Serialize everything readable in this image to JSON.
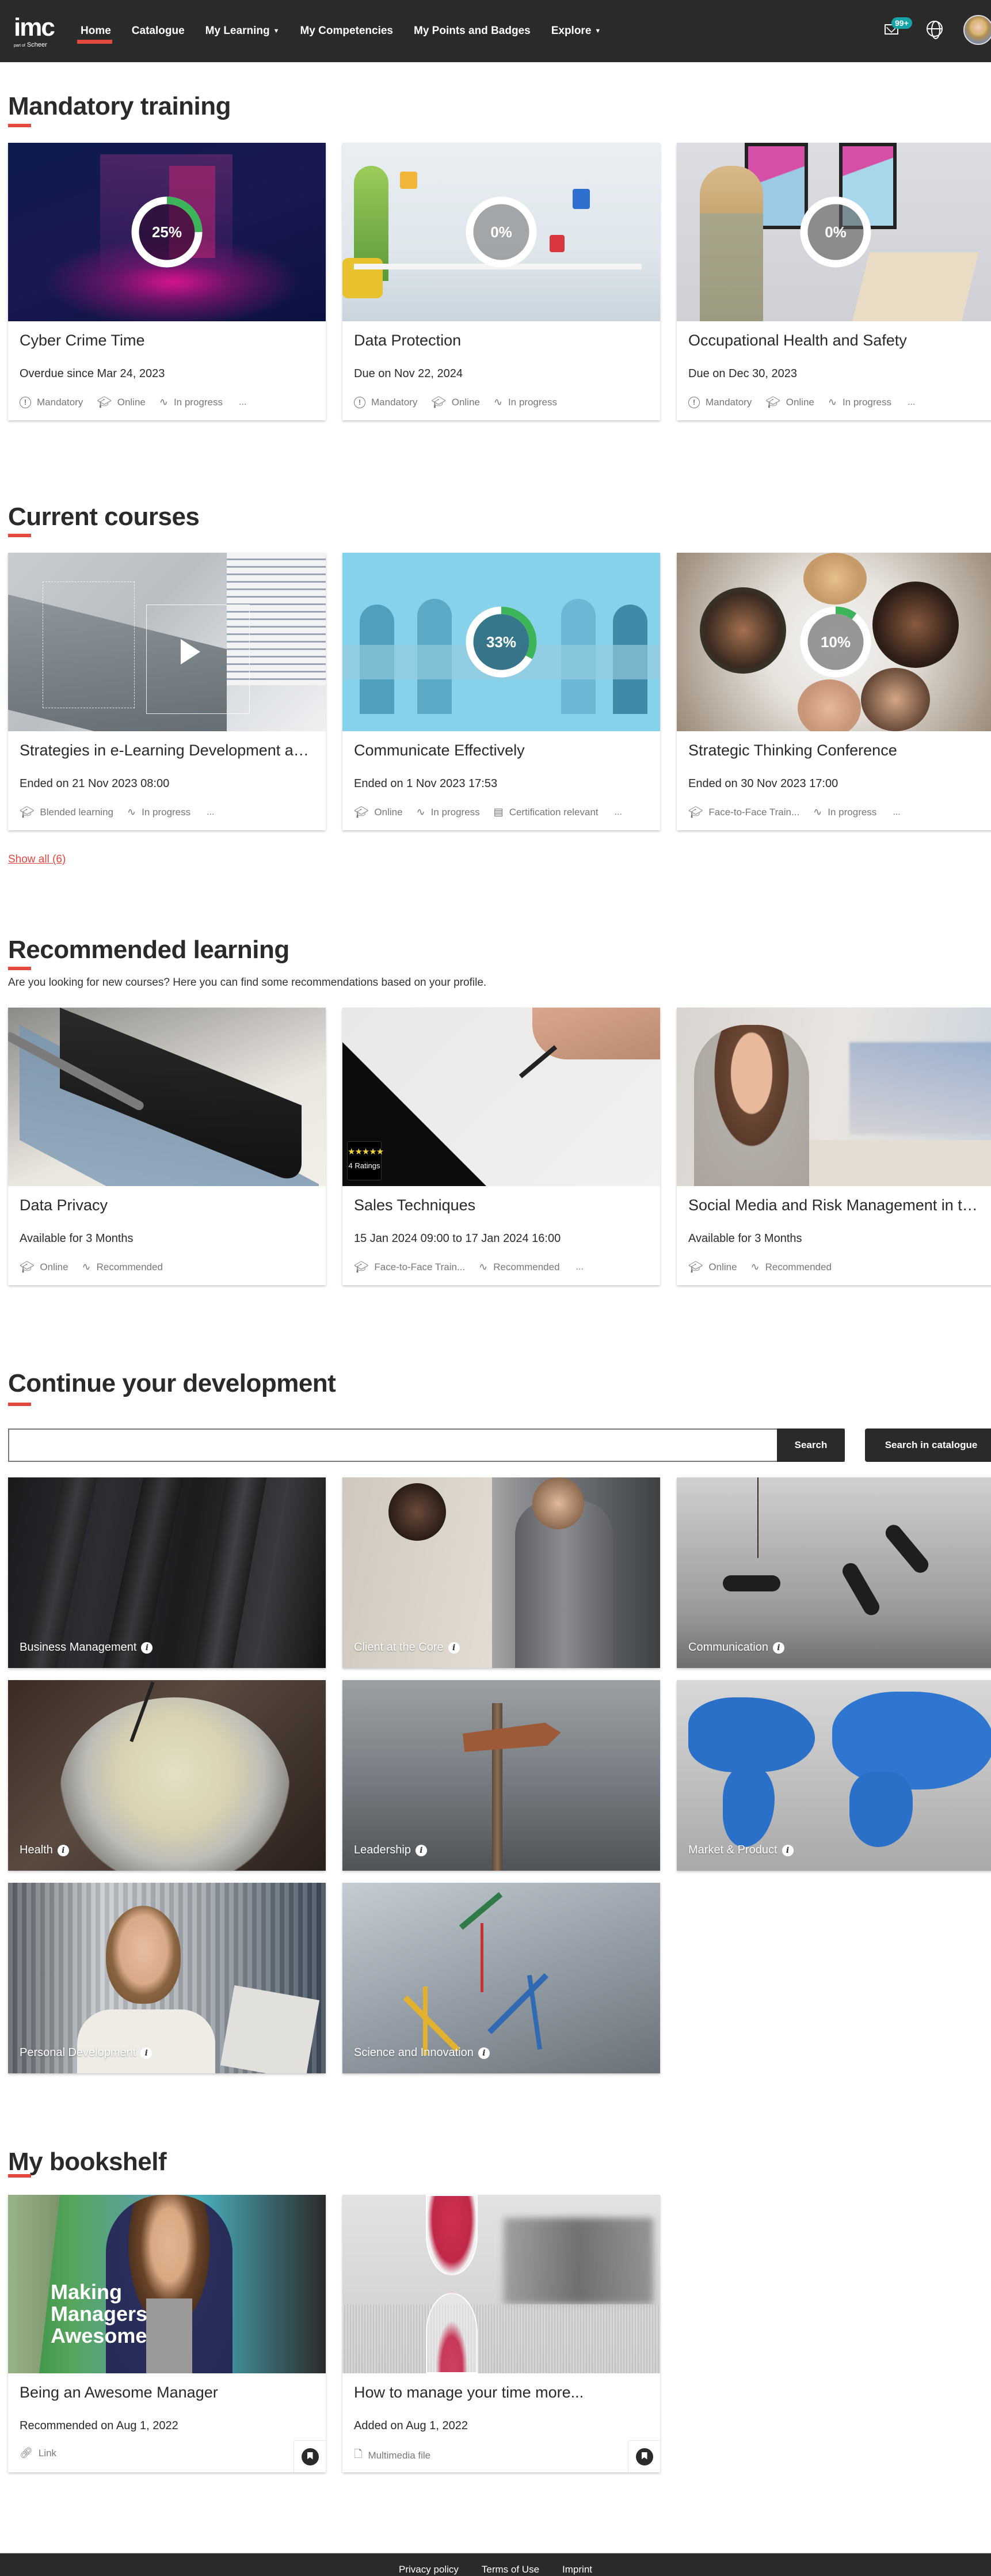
{
  "nav": {
    "logo_main": "imc",
    "logo_sub_prefix": "part of",
    "logo_sub": "Scheer",
    "items": [
      {
        "label": "Home",
        "active": true,
        "dropdown": false
      },
      {
        "label": "Catalogue",
        "active": false,
        "dropdown": false
      },
      {
        "label": "My Learning",
        "active": false,
        "dropdown": true
      },
      {
        "label": "My Competencies",
        "active": false,
        "dropdown": false
      },
      {
        "label": "My Points and Badges",
        "active": false,
        "dropdown": false
      },
      {
        "label": "Explore",
        "active": false,
        "dropdown": true
      }
    ],
    "caret": "▼",
    "mail_badge": "99+",
    "icons": {
      "mail": "mail-icon",
      "language": "globe-icon",
      "user": "avatar"
    }
  },
  "mandatory": {
    "title": "Mandatory training",
    "cards": [
      {
        "title": "Cyber Crime Time",
        "date": "Overdue since Mar 24, 2023",
        "progress": "25%",
        "progress_value": 25,
        "meta": [
          {
            "icon": "exclamation-circle-icon",
            "label": "Mandatory"
          },
          {
            "icon": "graduation-cap-icon",
            "label": "Online"
          },
          {
            "icon": "pulse-icon",
            "label": "In progress"
          }
        ],
        "more": "..."
      },
      {
        "title": "Data Protection",
        "date": "Due on Nov 22, 2024",
        "progress": "0%",
        "progress_value": 0,
        "meta": [
          {
            "icon": "exclamation-circle-icon",
            "label": "Mandatory"
          },
          {
            "icon": "graduation-cap-icon",
            "label": "Online"
          },
          {
            "icon": "pulse-icon",
            "label": "In progress"
          }
        ],
        "more": ""
      },
      {
        "title": "Occupational Health and Safety",
        "date": "Due on Dec 30, 2023",
        "progress": "0%",
        "progress_value": 0,
        "meta": [
          {
            "icon": "exclamation-circle-icon",
            "label": "Mandatory"
          },
          {
            "icon": "graduation-cap-icon",
            "label": "Online"
          },
          {
            "icon": "pulse-icon",
            "label": "In progress"
          }
        ],
        "more": "..."
      }
    ]
  },
  "current": {
    "title": "Current courses",
    "cards": [
      {
        "title": "Strategies in e-Learning Development and...",
        "date": "Ended on 21 Nov 2023 08:00",
        "meta": [
          {
            "icon": "graduation-cap-icon",
            "label": "Blended learning"
          },
          {
            "icon": "pulse-icon",
            "label": "In progress"
          }
        ],
        "more": "..."
      },
      {
        "title": "Communicate Effectively",
        "date": "Ended on 1 Nov 2023 17:53",
        "progress": "33%",
        "progress_value": 33,
        "meta": [
          {
            "icon": "graduation-cap-icon",
            "label": "Online"
          },
          {
            "icon": "pulse-icon",
            "label": "In progress"
          },
          {
            "icon": "certificate-icon",
            "label": "Certification relevant"
          }
        ],
        "more": "..."
      },
      {
        "title": "Strategic Thinking Conference",
        "date": "Ended on 30 Nov 2023 17:00",
        "progress": "10%",
        "progress_value": 10,
        "meta": [
          {
            "icon": "graduation-cap-icon",
            "label": "Face-to-Face Train..."
          },
          {
            "icon": "pulse-icon",
            "label": "In progress"
          }
        ],
        "more": "..."
      }
    ],
    "show_all": "Show all (6)"
  },
  "recommended": {
    "title": "Recommended learning",
    "description": "Are you looking for new courses? Here you can find some recommendations based on your profile.",
    "cards": [
      {
        "title": "Data Privacy",
        "date": "Available for 3 Months",
        "meta": [
          {
            "icon": "graduation-cap-icon",
            "label": "Online"
          },
          {
            "icon": "pulse-icon",
            "label": "Recommended"
          }
        ],
        "more": ""
      },
      {
        "title": "Sales Techniques",
        "date": "15 Jan 2024 09:00 to 17 Jan 2024 16:00",
        "rating": {
          "stars": "★★★★★",
          "value": 5,
          "count_label": "4 Ratings"
        },
        "meta": [
          {
            "icon": "graduation-cap-icon",
            "label": "Face-to-Face Train..."
          },
          {
            "icon": "pulse-icon",
            "label": "Recommended"
          }
        ],
        "more": "..."
      },
      {
        "title": "Social Media and Risk Management in the...",
        "date": "Available for 3 Months",
        "meta": [
          {
            "icon": "graduation-cap-icon",
            "label": "Online"
          },
          {
            "icon": "pulse-icon",
            "label": "Recommended"
          }
        ],
        "more": ""
      }
    ]
  },
  "development": {
    "title": "Continue your development",
    "search_value": "",
    "search_placeholder": "",
    "search_button": "Search",
    "catalogue_button": "Search in catalogue",
    "tiles": [
      {
        "label": "Business Management"
      },
      {
        "label": "Client at the Core"
      },
      {
        "label": "Communication"
      },
      {
        "label": "Health"
      },
      {
        "label": "Leadership"
      },
      {
        "label": "Market & Product"
      },
      {
        "label": "Personal Development"
      },
      {
        "label": "Science and Innovation"
      }
    ],
    "info_glyph": "i"
  },
  "bookshelf": {
    "title": "My bookshelf",
    "cards": [
      {
        "title": "Being an Awesome Manager",
        "date": "Recommended on Aug 1, 2022",
        "image_text": "Making Managers Awesome",
        "meta": [
          {
            "icon": "link-icon",
            "label": "Link"
          }
        ]
      },
      {
        "title": "How to manage your time more...",
        "date": "Added on Aug 1, 2022",
        "meta": [
          {
            "icon": "multimedia-file-icon",
            "label": "Multimedia file"
          }
        ]
      }
    ]
  },
  "footer": {
    "links": [
      "Privacy policy",
      "Terms of Use",
      "Imprint"
    ]
  },
  "colors": {
    "navbar": "#2a2a2a",
    "accent_red": "#e2483d",
    "progress_green": "#3cb55a",
    "badge_teal": "#16a4a8",
    "button_dark": "#2a2a2a"
  }
}
